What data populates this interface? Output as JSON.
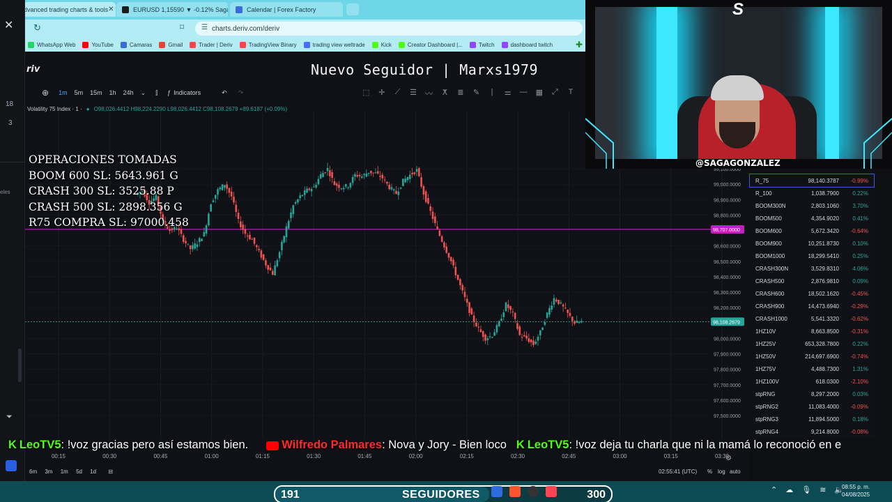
{
  "browser": {
    "tabs": [
      {
        "label": "Advanced trading charts & tools",
        "active": true,
        "color": "#ff444f"
      },
      {
        "label": "EURUSD 1,15590 ▼ -0.12% Saga",
        "active": false,
        "color": "#1c1c1c"
      },
      {
        "label": "Calendar | Forex Factory",
        "active": false,
        "color": "#3b6bd9"
      }
    ],
    "url": "charts.deriv.com/deriv",
    "bookmarks": [
      {
        "label": "WhatsApp Web",
        "color": "#25d366"
      },
      {
        "label": "YouTube",
        "color": "#ff0000"
      },
      {
        "label": "Camaras",
        "color": "#3b6bd9"
      },
      {
        "label": "Gmail",
        "color": "#ea4335"
      },
      {
        "label": "Trader | Deriv",
        "color": "#ff444f"
      },
      {
        "label": "TradingView Binary",
        "color": "#ff444f"
      },
      {
        "label": "trading view weltrade",
        "color": "#4b6cff"
      },
      {
        "label": "Kick",
        "color": "#53fc18"
      },
      {
        "label": "Creator Dashboard |...",
        "color": "#53fc18"
      },
      {
        "label": "Twitch",
        "color": "#9146ff"
      },
      {
        "label": "dashboard twitch",
        "color": "#9146ff"
      }
    ]
  },
  "left_strip": {
    "n1": "18",
    "n2": "3",
    "label": "eles"
  },
  "app": {
    "brand": "riv",
    "overlay_title": "Nuevo Seguidor | Marxs1979",
    "toolbar": {
      "timeframes": [
        "1m",
        "5m",
        "15m",
        "1h",
        "24h"
      ],
      "active_timeframe": "1m",
      "indicators": "Indicators"
    },
    "symbol": "Volatility 75 Index · 1 ·",
    "ohlc": "O98,026.4412 H98,224.2290 L98,026.4412 C98,108.2679 +89.6187 (+0.09%)",
    "operations": [
      "OPERACIONES TOMADAS",
      "BOOM 600 SL: 5643.961 G",
      "CRASH 300 SL: 3525.88 P",
      "CRASH 500 SL: 2898.356 G",
      "R75 COMPRA SL: 97000.458"
    ],
    "bottom": {
      "ranges": [
        "6m",
        "3m",
        "1m",
        "5d",
        "1d"
      ],
      "clock": "02:55:41 (UTC)",
      "pct": "%",
      "log": "log",
      "auto": "auto"
    }
  },
  "chart_data": {
    "type": "candlestick",
    "series": [
      {
        "name": "Volatility 75 Index",
        "ohlc_last": {
          "o": 98026.4412,
          "h": 98224.229,
          "l": 98026.4412,
          "c": 98108.2679
        }
      }
    ],
    "x": [
      "00:15",
      "00:30",
      "00:45",
      "01:00",
      "01:15",
      "01:30",
      "01:45",
      "02:00",
      "02:15",
      "02:30",
      "02:45",
      "03:00",
      "03:15",
      "03:30"
    ],
    "y_ticks": [
      "99,100.0000",
      "99,000.0000",
      "98,900.0000",
      "98,800.0000",
      "98,600.0000",
      "98,500.0000",
      "98,400.0000",
      "98,300.0000",
      "98,200.0000",
      "98,000.0000",
      "97,900.0000",
      "97,800.0000",
      "97,700.0000",
      "97,600.0000",
      "97,500.0000"
    ],
    "ylim": [
      97500,
      99100
    ],
    "levels": [
      {
        "value": 98707,
        "label": "98,707.0000",
        "color": "#c020c0"
      },
      {
        "value": 98108.2679,
        "label": "98,108.2679",
        "color": "#26a69a"
      }
    ],
    "close_path": [
      98930,
      98960,
      98880,
      98920,
      98760,
      98700,
      98720,
      98640,
      98580,
      98620,
      98680,
      98880,
      98960,
      99000,
      98920,
      98760,
      98680,
      98640,
      98560,
      98480,
      98420,
      98560,
      98720,
      98860,
      98920,
      98960,
      98980,
      99060,
      99100,
      99000,
      98980,
      98990,
      99060,
      99050,
      99080,
      99070,
      99040,
      98980,
      98940,
      99020,
      99060,
      99090,
      98940,
      98820,
      98700,
      98600,
      98500,
      98380,
      98260,
      98140,
      98060,
      98000,
      98020,
      98100,
      98220,
      98160,
      98020,
      98000,
      97960,
      98040,
      98160,
      98260,
      98220,
      98160,
      98100,
      98108
    ]
  },
  "watchlist": [
    {
      "symbol": "R_75",
      "price": "98,140.3787",
      "change": "-0.99%",
      "dir": "down",
      "selected": true
    },
    {
      "symbol": "R_100",
      "price": "1,038.7900",
      "change": "0.22%",
      "dir": "up"
    },
    {
      "symbol": "BOOM300N",
      "price": "2,803.1060",
      "change": "3.70%",
      "dir": "up"
    },
    {
      "symbol": "BOOM500",
      "price": "4,354.9020",
      "change": "0.41%",
      "dir": "up"
    },
    {
      "symbol": "BOOM600",
      "price": "5,672.3420",
      "change": "-0.64%",
      "dir": "down"
    },
    {
      "symbol": "BOOM900",
      "price": "10,251.8730",
      "change": "0.10%",
      "dir": "up"
    },
    {
      "symbol": "BOOM1000",
      "price": "18,299.5410",
      "change": "0.25%",
      "dir": "up"
    },
    {
      "symbol": "CRASH300N",
      "price": "3,529.8310",
      "change": "4.06%",
      "dir": "up"
    },
    {
      "symbol": "CRASH500",
      "price": "2,876.9810",
      "change": "0.09%",
      "dir": "up"
    },
    {
      "symbol": "CRASH600",
      "price": "18,502.1620",
      "change": "-0.45%",
      "dir": "down"
    },
    {
      "symbol": "CRASH900",
      "price": "14,473.6940",
      "change": "-0.29%",
      "dir": "down"
    },
    {
      "symbol": "CRASH1000",
      "price": "5,541.3320",
      "change": "-0.62%",
      "dir": "down"
    },
    {
      "symbol": "1HZ10V",
      "price": "8,663.8500",
      "change": "-0.31%",
      "dir": "down"
    },
    {
      "symbol": "1HZ25V",
      "price": "653,328.7800",
      "change": "0.22%",
      "dir": "up"
    },
    {
      "symbol": "1HZ50V",
      "price": "214,697.6900",
      "change": "-0.74%",
      "dir": "down"
    },
    {
      "symbol": "1HZ75V",
      "price": "4,488.7300",
      "change": "1.31%",
      "dir": "up"
    },
    {
      "symbol": "1HZ100V",
      "price": "618.0300",
      "change": "-2.10%",
      "dir": "down"
    },
    {
      "symbol": "stpRNG",
      "price": "8,297.2000",
      "change": "0.03%",
      "dir": "up"
    },
    {
      "symbol": "stpRNG2",
      "price": "11,083.4000",
      "change": "-0.09%",
      "dir": "down"
    },
    {
      "symbol": "stpRNG3",
      "price": "11,894.5000",
      "change": "0.18%",
      "dir": "up"
    },
    {
      "symbol": "stpRNG4",
      "price": "9,214.8000",
      "change": "-0.08%",
      "dir": "down"
    }
  ],
  "chat": [
    {
      "platform": "kick",
      "user": "LeoTV5",
      "message": ": !voz gracias pero así estamos bien."
    },
    {
      "platform": "youtube",
      "user": "Wilfredo Palmares",
      "message": ": Nova y Jory - Bien loco"
    },
    {
      "platform": "kick",
      "user": "LeoTV5",
      "message": ": !voz deja tu charla que ni la mamá lo reconoció en e"
    }
  ],
  "webcam": {
    "tag": "@SAGAGONZALEZ",
    "logo": "S"
  },
  "follower_goal": {
    "current": "191",
    "label": "SEGUIDORES",
    "goal": "300",
    "progress": 0.6367
  },
  "system_tray": {
    "time": "08:55 p. m.",
    "date": "04/08/2025"
  }
}
